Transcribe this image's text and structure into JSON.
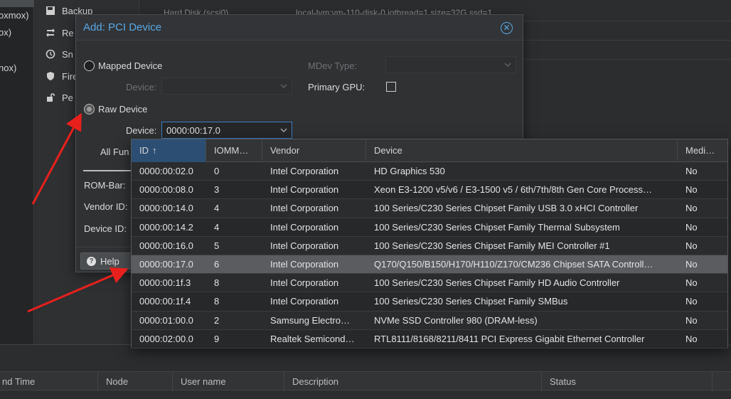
{
  "tree": {
    "items": [
      "oxmox)",
      "ox)",
      "nox)"
    ]
  },
  "side_menu": {
    "items": [
      {
        "label": "Backup",
        "icon": "floppy-icon"
      },
      {
        "label": "Re",
        "icon": "retweet-icon"
      },
      {
        "label": "Sn",
        "icon": "history-icon"
      },
      {
        "label": "Fire",
        "icon": "shield-icon"
      },
      {
        "label": "Pe",
        "icon": "unlock-icon"
      }
    ]
  },
  "hardware": {
    "rows": [
      {
        "name": "Hard Disk (scsi0)",
        "value": "local-lvm:vm-110-disk-0,iothread=1,size=32G,ssd=1"
      }
    ]
  },
  "dialog": {
    "title": "Add: PCI Device",
    "mapped_device_label": "Mapped Device",
    "raw_device_label": "Raw Device",
    "device_label": "Device:",
    "raw_device_value": "0000:00:17.0",
    "mdev_type_label": "MDev Type:",
    "primary_gpu_label": "Primary GPU:",
    "all_functions_label": "All Fun",
    "rom_bar_label": "ROM-Bar:",
    "vendor_id_label": "Vendor ID:",
    "device_id_label": "Device ID:",
    "help_label": "Help"
  },
  "picker": {
    "columns": [
      "ID",
      "IOMM…",
      "Vendor",
      "Device",
      "Medi…"
    ],
    "selected_index": 5,
    "rows": [
      {
        "id": "0000:00:02.0",
        "iommu": "0",
        "vendor": "Intel Corporation",
        "device": "HD Graphics 530",
        "mdev": "No"
      },
      {
        "id": "0000:00:08.0",
        "iommu": "3",
        "vendor": "Intel Corporation",
        "device": "Xeon E3-1200 v5/v6 / E3-1500 v5 / 6th/7th/8th Gen Core Process…",
        "mdev": "No"
      },
      {
        "id": "0000:00:14.0",
        "iommu": "4",
        "vendor": "Intel Corporation",
        "device": "100 Series/C230 Series Chipset Family USB 3.0 xHCI Controller",
        "mdev": "No"
      },
      {
        "id": "0000:00:14.2",
        "iommu": "4",
        "vendor": "Intel Corporation",
        "device": "100 Series/C230 Series Chipset Family Thermal Subsystem",
        "mdev": "No"
      },
      {
        "id": "0000:00:16.0",
        "iommu": "5",
        "vendor": "Intel Corporation",
        "device": "100 Series/C230 Series Chipset Family MEI Controller #1",
        "mdev": "No"
      },
      {
        "id": "0000:00:17.0",
        "iommu": "6",
        "vendor": "Intel Corporation",
        "device": "Q170/Q150/B150/H170/H110/Z170/CM236 Chipset SATA Controll…",
        "mdev": "No"
      },
      {
        "id": "0000:00:1f.3",
        "iommu": "8",
        "vendor": "Intel Corporation",
        "device": "100 Series/C230 Series Chipset Family HD Audio Controller",
        "mdev": "No"
      },
      {
        "id": "0000:00:1f.4",
        "iommu": "8",
        "vendor": "Intel Corporation",
        "device": "100 Series/C230 Series Chipset Family SMBus",
        "mdev": "No"
      },
      {
        "id": "0000:01:00.0",
        "iommu": "2",
        "vendor": "Samsung Electro…",
        "device": "NVMe SSD Controller 980 (DRAM-less)",
        "mdev": "No"
      },
      {
        "id": "0000:02:00.0",
        "iommu": "9",
        "vendor": "Realtek Semicond…",
        "device": "RTL8111/8168/8211/8411 PCI Express Gigabit Ethernet Controller",
        "mdev": "No"
      }
    ]
  },
  "tasks": {
    "columns": [
      "nd Time",
      "Node",
      "User name",
      "Description",
      "Status"
    ]
  },
  "colors": {
    "accent": "#5aa9e6",
    "annotation_arrow": "#e8201c",
    "selected_row": "#5a5c5f",
    "sorted_header": "#2c4e73"
  }
}
